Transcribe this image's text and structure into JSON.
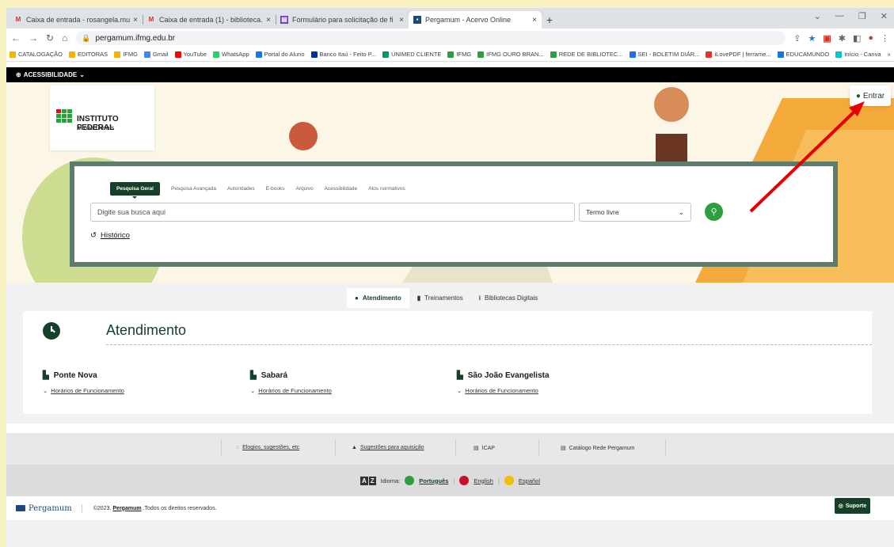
{
  "browser": {
    "tabs": [
      {
        "label": "Caixa de entrada - rosangela.mu",
        "favicon": "gmail-icon",
        "active": false
      },
      {
        "label": "Caixa de entrada (1) - biblioteca.",
        "favicon": "gmail-icon",
        "active": false
      },
      {
        "label": "Formulário para solicitação de fi",
        "favicon": "forms-icon",
        "active": false
      },
      {
        "label": "Pergamum - Acervo Online",
        "favicon": "pergamum-icon",
        "active": true
      }
    ],
    "new_tab": "+",
    "url": "pergamum.ifmg.edu.br",
    "bookmarks": [
      {
        "label": "CATALOGAÇÃO",
        "color": "#f4b400"
      },
      {
        "label": "EDITORAS",
        "color": "#f4b400"
      },
      {
        "label": "IFMG",
        "color": "#f4b400"
      },
      {
        "label": "Gmail",
        "color": "#4285f4"
      },
      {
        "label": "YouTube",
        "color": "#ff0000"
      },
      {
        "label": "WhatsApp",
        "color": "#25d366"
      },
      {
        "label": "Portal do Aluno",
        "color": "#1a73e8"
      },
      {
        "label": "Banco Itaú - Feito P...",
        "color": "#003399"
      },
      {
        "label": "UNIMED CLIENTE",
        "color": "#00995d"
      },
      {
        "label": "IFMG",
        "color": "#2f9e41"
      },
      {
        "label": "IFMG OURO BRAN...",
        "color": "#2f9e41"
      },
      {
        "label": "REDE DE BIBLIOTEC...",
        "color": "#2f9e41"
      },
      {
        "label": "SEI - BOLETIM DIÁR...",
        "color": "#1a73e8"
      },
      {
        "label": "iLovePDF | ferrame...",
        "color": "#e5322d"
      },
      {
        "label": "EDUCAMUNDO",
        "color": "#1a73e8"
      },
      {
        "label": "Início - Canva",
        "color": "#00c4cc"
      }
    ],
    "bookmarks_more": "»"
  },
  "accessibility": {
    "label": "ACESSIBILIDADE"
  },
  "hero": {
    "logo_title": "INSTITUTO FEDERAL",
    "logo_subtitle": "Minas Gerais",
    "login_label": "Entrar"
  },
  "search": {
    "tabs": [
      "Pesquisa Geral",
      "Pesquisa Avançada",
      "Autoridades",
      "E-books",
      "Arquivo",
      "Acessibilidade",
      "Atos normativos"
    ],
    "active_tab": "Pesquisa Geral",
    "placeholder": "Digite sua busca aqui",
    "select_value": "Termo livre",
    "history_label": "Histórico"
  },
  "attendance": {
    "tabs": [
      {
        "label": "Atendimento",
        "icon": "clock-icon",
        "glyph": "●"
      },
      {
        "label": "Treinamentos",
        "icon": "bookmark-icon",
        "glyph": "▮"
      },
      {
        "label": "Bibliotecas Digitais",
        "icon": "info-icon",
        "glyph": "i"
      }
    ],
    "title": "Atendimento",
    "campuses": [
      {
        "name": "Ponte Nova",
        "hours_label": "Horários de Funcionamento"
      },
      {
        "name": "Sabará",
        "hours_label": "Horários de Funcionamento"
      },
      {
        "name": "São João Evangelista",
        "hours_label": "Horários de Funcionamento"
      }
    ]
  },
  "footer": {
    "links": [
      {
        "label": "Elogios, sugestões, etc",
        "icon": "comment-icon",
        "glyph": "◌"
      },
      {
        "label": "Sugestões para aquisição",
        "icon": "bag-icon",
        "glyph": "▲"
      },
      {
        "label": "ICAP",
        "icon": "database-icon",
        "glyph": "▤"
      },
      {
        "label": "Catálogo Rede Pergamum",
        "icon": "database-icon",
        "glyph": "▤"
      }
    ],
    "language_label": "Idioma:",
    "languages": [
      {
        "label": "Português",
        "color": "#2f9e41"
      },
      {
        "label": "English",
        "color": "#c8102e"
      },
      {
        "label": "Español",
        "color": "#f1bf00"
      }
    ],
    "brand": "Pergamum",
    "copyright_prefix": "©2023.",
    "copyright_brand": "Pergamum",
    "copyright_suffix": ".Todos os direitos reservados.",
    "support_label": "Suporte"
  }
}
